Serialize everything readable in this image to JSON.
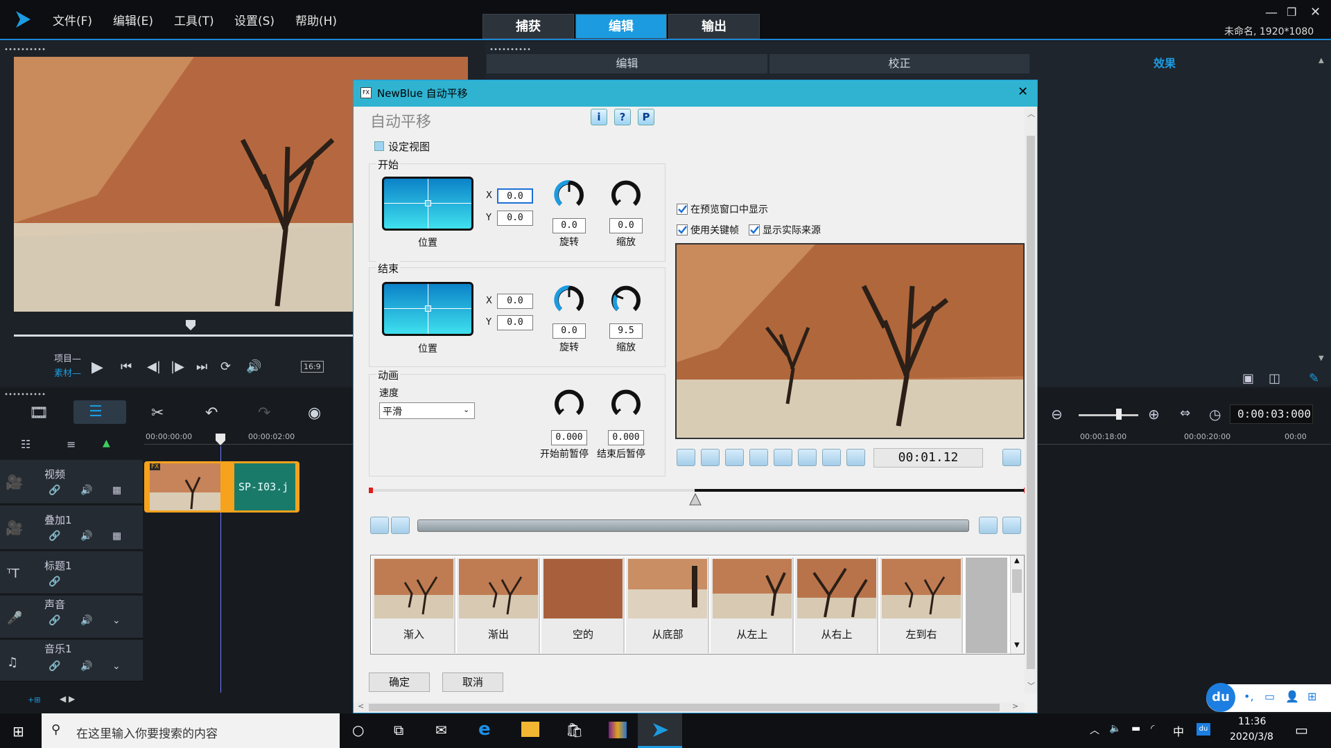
{
  "menu": {
    "file": "文件(F)",
    "edit": "编辑(E)",
    "tools": "工具(T)",
    "settings": "设置(S)",
    "help": "帮助(H)"
  },
  "mode_tabs": {
    "capture": "捕获",
    "edit": "编辑",
    "output": "输出"
  },
  "project": {
    "name": "未命名, 1920*1080"
  },
  "right_tabs": {
    "edit": "编辑",
    "correct": "校正",
    "effect": "效果"
  },
  "preview_labels": {
    "project": "项目—",
    "clip": "素材—",
    "aspect": "16:9"
  },
  "timeline": {
    "ruler": [
      "00:00:00:00",
      "00:00:02:00",
      "00:00:18:00",
      "00:00:20:00",
      "00:00"
    ],
    "timecode": "0:00:03:000",
    "clip": {
      "label": "SP-I03.j",
      "fx": "FX"
    },
    "tracks": [
      "视频",
      "叠加1",
      "标题1",
      "声音",
      "音乐1"
    ]
  },
  "dialog": {
    "title": "NewBlue 自动平移",
    "heading": "自动平移",
    "help_buttons": {
      "info": "i",
      "help": "?",
      "preset": "P"
    },
    "set_view_label": "设定视图",
    "start": {
      "label": "开始",
      "x": "0.0",
      "y": "0.0",
      "rotation": "0.0",
      "zoom": "0.0",
      "pos_label": "位置",
      "rot_label": "旋转",
      "zoom_label": "缩放"
    },
    "end": {
      "label": "结束",
      "x": "0.0",
      "y": "0.0",
      "rotation": "0.0",
      "zoom": "9.5",
      "pos_label": "位置",
      "rot_label": "旋转",
      "zoom_label": "缩放"
    },
    "animation": {
      "label": "动画",
      "speed_label": "速度",
      "speed_value": "平滑",
      "pre_pause": "0.000",
      "post_pause": "0.000",
      "pre_label": "开始前暂停",
      "post_label": "结束后暂停"
    },
    "options": {
      "show_in_preview": "在预览窗口中显示",
      "use_keyframes": "使用关键帧",
      "show_source": "显示实际来源"
    },
    "playhead_time": "00:01.12",
    "presets": [
      "渐入",
      "渐出",
      "空的",
      "从底部",
      "从左上",
      "从右上",
      "左到右"
    ],
    "ok": "确定",
    "cancel": "取消"
  },
  "taskbar": {
    "search_placeholder": "在这里输入你要搜索的内容",
    "time": "11:36",
    "date": "2020/3/8",
    "ime": "中"
  },
  "colors": {
    "accent": "#1c9be0",
    "dialog_title": "#2fb3d1",
    "clip": "#1a7a6a"
  }
}
